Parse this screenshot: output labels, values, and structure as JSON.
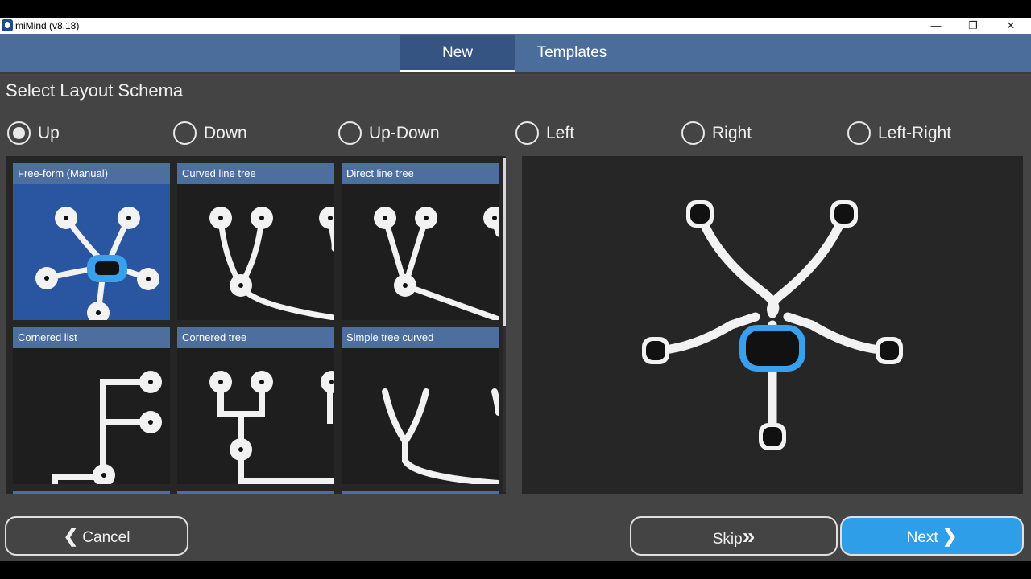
{
  "window": {
    "title": "miMind (v8.18)",
    "minimize_glyph": "—",
    "restore_glyph": "❐",
    "close_glyph": "✕"
  },
  "tabs": [
    {
      "label": "New",
      "active": true
    },
    {
      "label": "Templates",
      "active": false
    }
  ],
  "section_title": "Select Layout Schema",
  "orientations": [
    {
      "label": "Up",
      "checked": true
    },
    {
      "label": "Down",
      "checked": false
    },
    {
      "label": "Up-Down",
      "checked": false
    },
    {
      "label": "Left",
      "checked": false
    },
    {
      "label": "Right",
      "checked": false
    },
    {
      "label": "Left-Right",
      "checked": false
    }
  ],
  "layouts": [
    {
      "title": "Free-form (Manual)",
      "selected": true
    },
    {
      "title": "Curved line tree",
      "selected": false
    },
    {
      "title": "Direct line tree",
      "selected": false
    },
    {
      "title": "Cornered list",
      "selected": false
    },
    {
      "title": "Cornered tree",
      "selected": false
    },
    {
      "title": "Simple tree curved",
      "selected": false
    }
  ],
  "buttons": {
    "cancel": {
      "glyph": "❮",
      "label": "Cancel"
    },
    "skip": {
      "label": "Skip",
      "glyph": "»"
    },
    "next": {
      "label": "Next",
      "glyph": "❯"
    }
  },
  "colors": {
    "tabbar": "#4b6d9c",
    "accent": "#2f9ee8",
    "selected_card": "#2a55a0",
    "card_header": "#4d6fa0"
  }
}
